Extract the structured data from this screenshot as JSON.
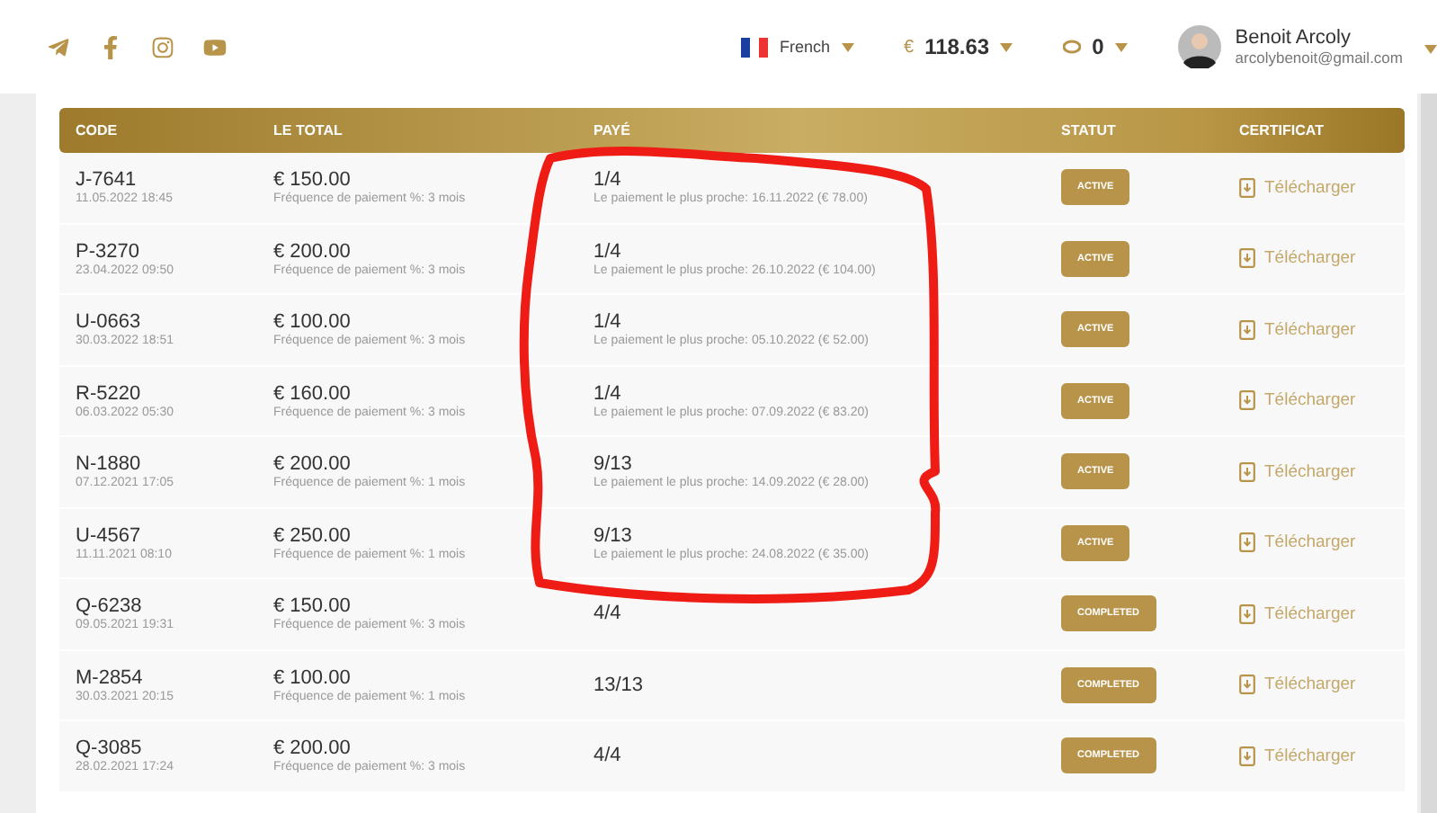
{
  "header": {
    "language": "French",
    "balance_currency": "€",
    "balance": "118.63",
    "coins": "0",
    "user": {
      "name": "Benoit Arcoly",
      "email": "arcolybenoit@gmail.com"
    }
  },
  "table": {
    "columns": [
      "CODE",
      "LE TOTAL",
      "PAYÉ",
      "STATUT",
      "CERTIFICAT"
    ],
    "rows": [
      {
        "code": "J-7641",
        "date": "11.05.2022 18:45",
        "total": "€ 150.00",
        "frequency": "Fréquence de paiement %: 3 mois",
        "paid": "1/4",
        "next_payment": "Le paiement le plus proche: 16.11.2022 (€ 78.00)",
        "status": "ACTIVE",
        "certificate": "Télécharger"
      },
      {
        "code": "P-3270",
        "date": "23.04.2022 09:50",
        "total": "€ 200.00",
        "frequency": "Fréquence de paiement %: 3 mois",
        "paid": "1/4",
        "next_payment": "Le paiement le plus proche: 26.10.2022 (€ 104.00)",
        "status": "ACTIVE",
        "certificate": "Télécharger"
      },
      {
        "code": "U-0663",
        "date": "30.03.2022 18:51",
        "total": "€ 100.00",
        "frequency": "Fréquence de paiement %: 3 mois",
        "paid": "1/4",
        "next_payment": "Le paiement le plus proche: 05.10.2022 (€ 52.00)",
        "status": "ACTIVE",
        "certificate": "Télécharger"
      },
      {
        "code": "R-5220",
        "date": "06.03.2022 05:30",
        "total": "€ 160.00",
        "frequency": "Fréquence de paiement %: 3 mois",
        "paid": "1/4",
        "next_payment": "Le paiement le plus proche: 07.09.2022 (€ 83.20)",
        "status": "ACTIVE",
        "certificate": "Télécharger"
      },
      {
        "code": "N-1880",
        "date": "07.12.2021 17:05",
        "total": "€ 200.00",
        "frequency": "Fréquence de paiement %: 1 mois",
        "paid": "9/13",
        "next_payment": "Le paiement le plus proche: 14.09.2022 (€ 28.00)",
        "status": "ACTIVE",
        "certificate": "Télécharger"
      },
      {
        "code": "U-4567",
        "date": "11.11.2021 08:10",
        "total": "€ 250.00",
        "frequency": "Fréquence de paiement %: 1 mois",
        "paid": "9/13",
        "next_payment": "Le paiement le plus proche: 24.08.2022 (€ 35.00)",
        "status": "ACTIVE",
        "certificate": "Télécharger"
      },
      {
        "code": "Q-6238",
        "date": "09.05.2021 19:31",
        "total": "€ 150.00",
        "frequency": "Fréquence de paiement %: 3 mois",
        "paid": "4/4",
        "status": "COMPLETED",
        "certificate": "Télécharger"
      },
      {
        "code": "M-2854",
        "date": "30.03.2021 20:15",
        "total": "€ 100.00",
        "frequency": "Fréquence de paiement %: 1 mois",
        "paid": "13/13",
        "status": "COMPLETED",
        "certificate": "Télécharger"
      },
      {
        "code": "Q-3085",
        "date": "28.02.2021 17:24",
        "total": "€ 200.00",
        "frequency": "Fréquence de paiement %: 3 mois",
        "paid": "4/4",
        "status": "COMPLETED",
        "certificate": "Télécharger"
      }
    ]
  }
}
